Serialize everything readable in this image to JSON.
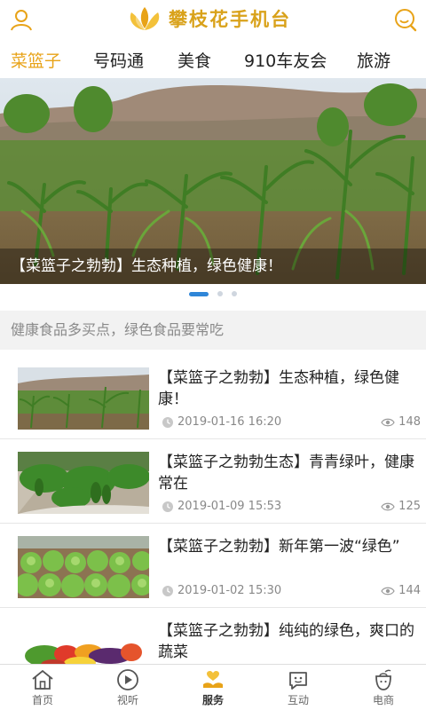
{
  "header": {
    "app_title": "攀枝花手机台",
    "user_icon": "user-icon",
    "search_icon": "search-icon",
    "accent_color": "#e8a318"
  },
  "tabs": [
    {
      "label": "菜篮子",
      "active": true
    },
    {
      "label": "号码通",
      "active": false
    },
    {
      "label": "美食",
      "active": false
    },
    {
      "label": "910车友会",
      "active": false
    },
    {
      "label": "旅游",
      "active": false
    }
  ],
  "banner": {
    "caption": "【菜篮子之勃勃】生态种植，绿色健康！",
    "slide_count": 3,
    "active_slide": 1
  },
  "notice": {
    "text": "健康食品多买点，绿色食品要常吃"
  },
  "news": [
    {
      "title": "【菜篮子之勃勃】生态种植，绿色健康！",
      "date": "2019-01-16 16:20",
      "views": "148",
      "thumb": "cornfield"
    },
    {
      "title": "【菜篮子之勃勃生态】青青绿叶，健康常在",
      "date": "2019-01-09 15:53",
      "views": "125",
      "thumb": "greenhouse"
    },
    {
      "title": "【菜篮子之勃勃】新年第一波“绿色”",
      "date": "2019-01-02 15:30",
      "views": "144",
      "thumb": "lettuce"
    },
    {
      "title": "【菜篮子之勃勃】纯纯的绿色，爽口的蔬菜",
      "date": "",
      "views": "",
      "thumb": "vegetables"
    }
  ],
  "bottom_nav": [
    {
      "label": "首页",
      "icon": "home-icon",
      "active": false
    },
    {
      "label": "视听",
      "icon": "play-icon",
      "active": false
    },
    {
      "label": "服务",
      "icon": "heart-hand-icon",
      "active": true
    },
    {
      "label": "互动",
      "icon": "chat-face-icon",
      "active": false
    },
    {
      "label": "电商",
      "icon": "bag-icon",
      "active": false
    }
  ]
}
